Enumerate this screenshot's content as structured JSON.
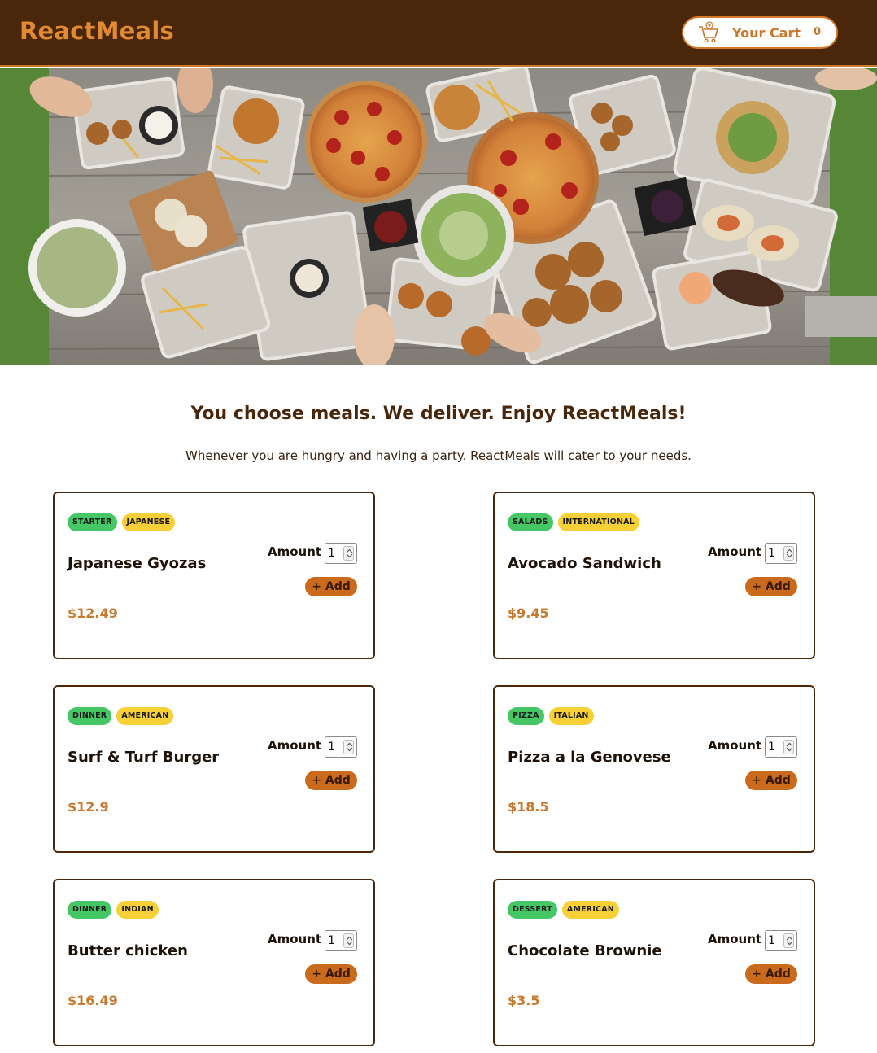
{
  "header": {
    "brand": "ReactMeals",
    "cart_label": "Your Cart",
    "cart_count": "0",
    "cart_icon": "cart-icon"
  },
  "intro": {
    "headline": "You choose meals. We deliver. Enjoy ReactMeals!",
    "subline": "Whenever you are hungry and having a party. ReactMeals will cater to your needs."
  },
  "colors": {
    "header_bg": "#4a260a",
    "accent": "#c9792e",
    "tag_category": "#44c764",
    "tag_cuisine": "#f7cf37",
    "add_button": "#c96a1c"
  },
  "meals": [
    {
      "name": "Japanese Gyozas",
      "price": "$12.49",
      "category": "STARTER",
      "cuisine": "JAPANESE",
      "amount_label": "Amount",
      "amount": "1",
      "add_label": "+ Add"
    },
    {
      "name": "Avocado Sandwich",
      "price": "$9.45",
      "category": "SALADS",
      "cuisine": "INTERNATIONAL",
      "amount_label": "Amount",
      "amount": "1",
      "add_label": "+ Add"
    },
    {
      "name": "Surf & Turf Burger",
      "price": "$12.9",
      "category": "DINNER",
      "cuisine": "AMERICAN",
      "amount_label": "Amount",
      "amount": "1",
      "add_label": "+ Add"
    },
    {
      "name": "Pizza a la Genovese",
      "price": "$18.5",
      "category": "PIZZA",
      "cuisine": "ITALIAN",
      "amount_label": "Amount",
      "amount": "1",
      "add_label": "+ Add"
    },
    {
      "name": "Butter chicken",
      "price": "$16.49",
      "category": "DINNER",
      "cuisine": "INDIAN",
      "amount_label": "Amount",
      "amount": "1",
      "add_label": "+ Add"
    },
    {
      "name": "Chocolate Brownie",
      "price": "$3.5",
      "category": "DESSERT",
      "cuisine": "AMERICAN",
      "amount_label": "Amount",
      "amount": "1",
      "add_label": "+ Add"
    }
  ]
}
